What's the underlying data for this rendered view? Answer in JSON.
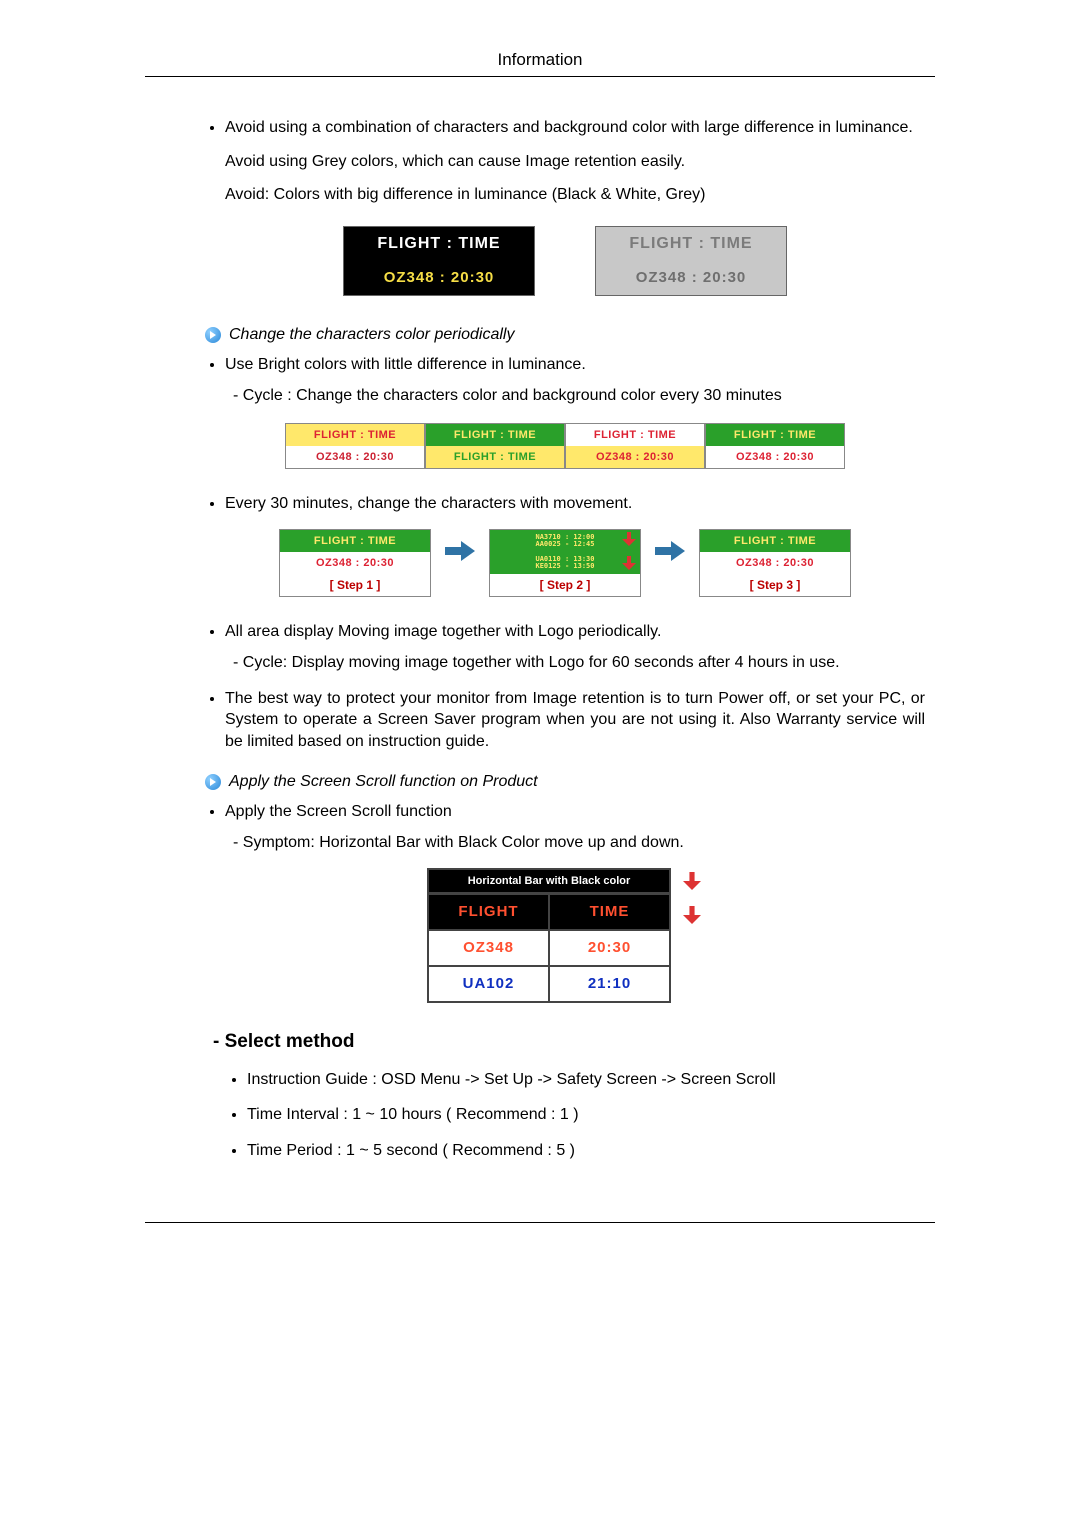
{
  "header": {
    "title": "Information"
  },
  "bullets_top": [
    {
      "main": "Avoid using a combination of characters and background color with large difference in luminance.",
      "subs": [
        "Avoid using Grey colors, which can cause Image retention easily.",
        "Avoid: Colors with big difference in luminance (Black & White, Grey)"
      ]
    }
  ],
  "panel1": {
    "a": {
      "r1": "FLIGHT  :  TIME",
      "r2": "OZ348    :   20:30"
    },
    "b": {
      "r1": "FLIGHT  :  TIME",
      "r2": "OZ348    :   20:30"
    }
  },
  "arrow_heads": {
    "change_colors": "Change the characters color periodically",
    "apply_scroll": "Apply the Screen Scroll function on Product"
  },
  "bullets_mid": [
    {
      "main": "Use Bright colors with little difference in luminance.",
      "subs": [
        "- Cycle : Change the characters color and background color every 30 minutes"
      ]
    }
  ],
  "panel2": [
    {
      "bg1": "#ffe86b",
      "fg1": "#d23",
      "r1": "FLIGHT  :  TIME",
      "bg2": "#fff",
      "fg2": "#c23",
      "r2": "OZ348    :   20:30"
    },
    {
      "bg1": "#2aa02a",
      "fg1": "#ffe86b",
      "r1": "FLIGHT  :  TIME",
      "bg2": "#ffe86b",
      "fg2": "#2aa02a",
      "r2": "FLIGHT  :  TIME"
    },
    {
      "bg1": "#fff",
      "fg1": "#d23",
      "r1": "FLIGHT : TIME",
      "bg2": "#ffe86b",
      "fg2": "#d23",
      "r2": "OZ348    :   20:30"
    },
    {
      "bg1": "#2aa02a",
      "fg1": "#ffe86b",
      "r1": "FLIGHT  :  TIME",
      "bg2": "#fff",
      "fg2": "#d23",
      "r2": "OZ348    :   20:30"
    }
  ],
  "bullets_movement": {
    "main": "Every 30 minutes, change the characters with movement."
  },
  "steps": {
    "s1": {
      "bg": "#2aa02a",
      "fg": "#ffe86b",
      "r1": "FLIGHT  :  TIME",
      "bg2": "#fff",
      "fg2": "#d23",
      "r2": "OZ348    :   20:30",
      "cap": "[ Step 1 ]"
    },
    "s2": {
      "bg": "#2aa02a",
      "fg": "#ffe86b",
      "r1_a": "NA3710  :  12:00",
      "r1_b": "AA0025  -  12:45",
      "r2_a": "UA0110  :  13:30",
      "r2_b": "KE0125  -  13:50",
      "cap": "[ Step 2 ]"
    },
    "s3": {
      "bg": "#2aa02a",
      "fg": "#ffe86b",
      "r1": "FLIGHT  :  TIME",
      "bg2": "#fff",
      "fg2": "#d23",
      "r2": "OZ348    :   20:30",
      "cap": "[ Step 3 ]"
    }
  },
  "bullets_after_steps": [
    {
      "main": "All area display Moving image together with Logo periodically.",
      "subs": [
        "- Cycle: Display moving image together with Logo for 60 seconds after 4 hours in use."
      ]
    },
    {
      "main": "The best way to protect your monitor from Image retention is to turn Power off, or set your PC, or System to operate a Screen Saver program when you are not using it. Also Warranty service will be limited based on instruction guide."
    }
  ],
  "bullets_scroll": [
    {
      "main": "Apply the Screen Scroll function",
      "subs": [
        "- Symptom: Horizontal Bar with Black Color move up and down."
      ]
    }
  ],
  "scroll_table": {
    "title": "Horizontal Bar with Black color",
    "rows": [
      {
        "c1": "FLIGHT",
        "c2": "TIME",
        "bg": "#000",
        "fg": "#ff5030"
      },
      {
        "c1": "OZ348",
        "c2": "20:30",
        "bg": "#fff",
        "fg": "#ff5030"
      },
      {
        "c1": "UA102",
        "c2": "21:10",
        "bg": "#fff",
        "fg": "#1030c0"
      }
    ]
  },
  "select_method": {
    "heading": "- Select method",
    "items": [
      "Instruction Guide : OSD Menu -> Set Up -> Safety Screen -> Screen Scroll",
      "Time Interval : 1 ~ 10 hours ( Recommend : 1 )",
      "Time Period : 1 ~ 5 second ( Recommend : 5 )"
    ]
  }
}
